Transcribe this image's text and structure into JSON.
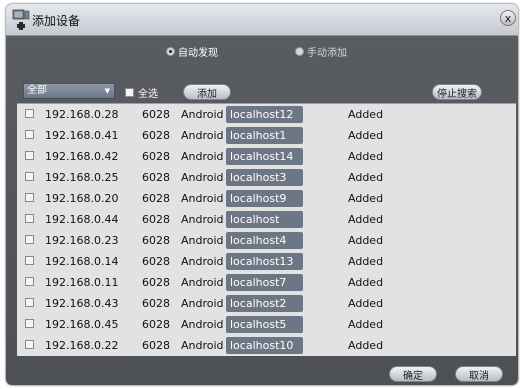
{
  "dialog": {
    "title": "添加设备",
    "close_label": "x"
  },
  "mode": {
    "auto_label": "自动发现",
    "manual_label": "手动添加",
    "selected": "auto"
  },
  "toolbar": {
    "filter_value": "全部",
    "select_all_label": "全选",
    "add_label": "添加",
    "stop_search_label": "停止搜索"
  },
  "devices": [
    {
      "ip": "192.168.0.28",
      "port": "6028",
      "os": "Android",
      "host": "localhost12",
      "status": "Added"
    },
    {
      "ip": "192.168.0.41",
      "port": "6028",
      "os": "Android",
      "host": "localhost1",
      "status": "Added"
    },
    {
      "ip": "192.168.0.42",
      "port": "6028",
      "os": "Android",
      "host": "localhost14",
      "status": "Added"
    },
    {
      "ip": "192.168.0.25",
      "port": "6028",
      "os": "Android",
      "host": "localhost3",
      "status": "Added"
    },
    {
      "ip": "192.168.0.20",
      "port": "6028",
      "os": "Android",
      "host": "localhost9",
      "status": "Added"
    },
    {
      "ip": "192.168.0.44",
      "port": "6028",
      "os": "Android",
      "host": "localhost",
      "status": "Added"
    },
    {
      "ip": "192.168.0.23",
      "port": "6028",
      "os": "Android",
      "host": "localhost4",
      "status": "Added"
    },
    {
      "ip": "192.168.0.14",
      "port": "6028",
      "os": "Android",
      "host": "localhost13",
      "status": "Added"
    },
    {
      "ip": "192.168.0.11",
      "port": "6028",
      "os": "Android",
      "host": "localhost7",
      "status": "Added"
    },
    {
      "ip": "192.168.0.43",
      "port": "6028",
      "os": "Android",
      "host": "localhost2",
      "status": "Added"
    },
    {
      "ip": "192.168.0.45",
      "port": "6028",
      "os": "Android",
      "host": "localhost5",
      "status": "Added"
    },
    {
      "ip": "192.168.0.22",
      "port": "6028",
      "os": "Android",
      "host": "localhost10",
      "status": "Added"
    }
  ],
  "footer": {
    "ok_label": "确定",
    "cancel_label": "取消"
  }
}
